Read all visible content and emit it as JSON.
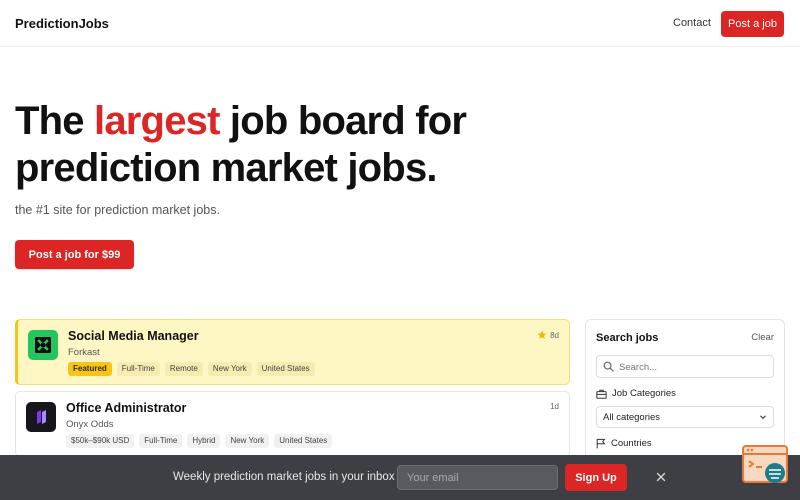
{
  "header": {
    "brand": "PredictionJobs",
    "contact": "Contact",
    "post_job": "Post a job"
  },
  "hero": {
    "title_pre": "The ",
    "title_accent": "largest",
    "title_post": " job board for prediction market jobs.",
    "subtitle": "the #1 site for prediction market jobs.",
    "cta": "Post a job for $99"
  },
  "jobs": [
    {
      "title": "Social Media Manager",
      "company": "Forkast",
      "tags": [
        "Featured",
        "Full-Time",
        "Remote",
        "New York",
        "United States"
      ],
      "age": "8d",
      "featured": true,
      "logo_color": "#22c55e",
      "logo_icon": "forkast-logo-icon"
    },
    {
      "title": "Office Administrator",
      "company": "Onyx Odds",
      "tags": [
        "$50k–$90k USD",
        "Full-Time",
        "Hybrid",
        "New York",
        "United States"
      ],
      "age": "1d",
      "featured": false,
      "logo_color": "#16161c",
      "logo_icon": "onyx-odds-logo-icon"
    }
  ],
  "search": {
    "title": "Search jobs",
    "clear": "Clear",
    "placeholder": "Search...",
    "categories_label": "Job Categories",
    "categories_value": "All categories",
    "countries_label": "Countries"
  },
  "newsletter": {
    "text": "Weekly prediction market jobs in your inbox",
    "placeholder": "Your email",
    "button": "Sign Up"
  },
  "colors": {
    "accent": "#dc2626",
    "featured_bg": "#fef7c3",
    "featured_border": "#f5c518",
    "newsletter_bg": "#3e3f44"
  }
}
